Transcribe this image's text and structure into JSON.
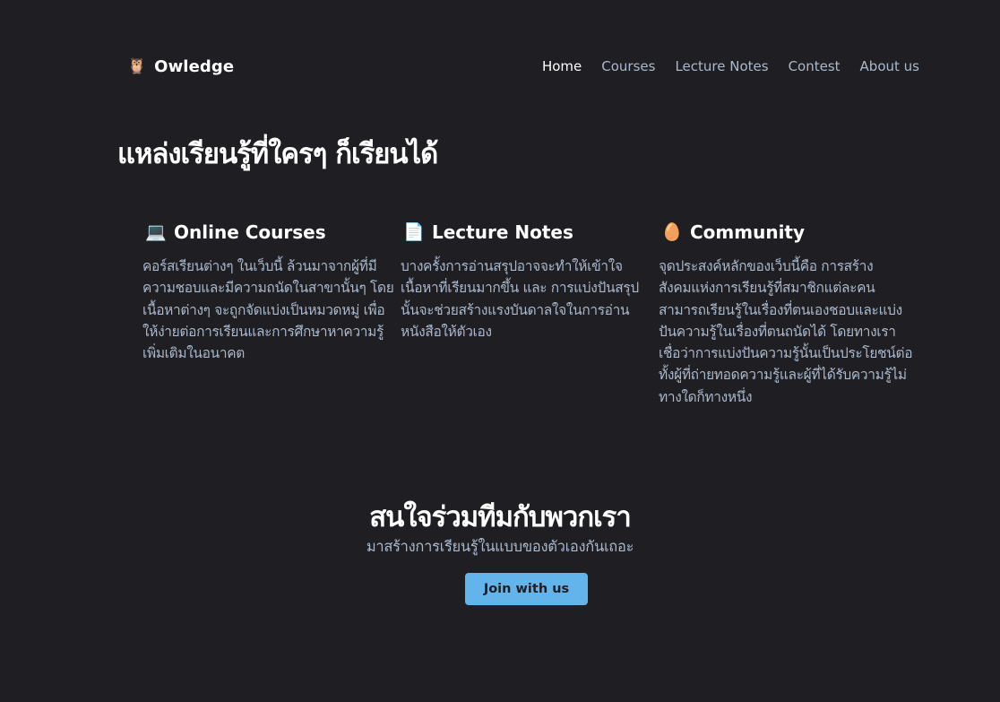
{
  "header": {
    "brand_icon": "🦉",
    "brand_name": "Owledge",
    "nav": [
      {
        "label": "Home",
        "active": true
      },
      {
        "label": "Courses",
        "active": false
      },
      {
        "label": "Lecture Notes",
        "active": false
      },
      {
        "label": "Contest",
        "active": false
      },
      {
        "label": "About us",
        "active": false
      }
    ]
  },
  "hero": {
    "title": "แหล่งเรียนรู้ที่ใครๆ ก็เรียนได้"
  },
  "features": [
    {
      "icon": "💻",
      "icon_name": "laptop-icon",
      "title": "Online Courses",
      "lines": [
        "คอร์สเรียนต่างๆ ในเว็บนี้ ล้วนมาจากผู้ที่มี",
        "ความชอบและมีความถนัดในสาขานั้นๆ โดย",
        "เนื้อหาต่างๆ จะถูกจัดแบ่งเป็นหมวดหมู่ เพื่อ",
        "ให้ง่ายต่อการเรียนและการศึกษาหาความรู้",
        "เพิ่มเติมในอนาคต"
      ]
    },
    {
      "icon": "📄",
      "icon_name": "document-icon",
      "title": "Lecture Notes",
      "lines": [
        "บางครั้งการอ่านสรุปอาจจะทำให้เข้าใจ",
        "เนื้อหาที่เรียนมากขึ้น และ การแบ่งปันสรุป",
        "นั้นจะช่วยสร้างแรงบันดาลใจในการอ่าน",
        "หนังสือให้ตัวเอง"
      ]
    },
    {
      "icon": "🥚",
      "icon_name": "egg-icon",
      "title": "Community",
      "lines": [
        "จุดประสงค์หลักของเว็บนี้คือ การสร้าง",
        "สังคมแห่งการเรียนรู้ที่สมาชิกแต่ละคน",
        "สามารถเรียนรู้ในเรื่องที่ตนเองชอบและแบ่ง",
        "ปันความรู้ในเรื่องที่ตนถนัดได้ โดยทางเรา",
        "เชื่อว่าการแบ่งปันความรู้นั้นเป็นประโยชน์ต่อ",
        "ทั้งผู้ที่ถ่ายทอดความรู้และผู้ที่ได้รับความรู้ไม่",
        "ทางใดก็ทางหนึ่ง"
      ]
    }
  ],
  "cta": {
    "title": "สนใจร่วมทีมกับพวกเรา",
    "subtitle": "มาสร้างการเรียนรู้ในแบบของตัวเองกันเถอะ",
    "button_label": "Join with us"
  },
  "colors": {
    "background": "#1f1e23",
    "text": "#ffffff",
    "muted": "#a9b8cc",
    "accent": "#62b4ea"
  }
}
